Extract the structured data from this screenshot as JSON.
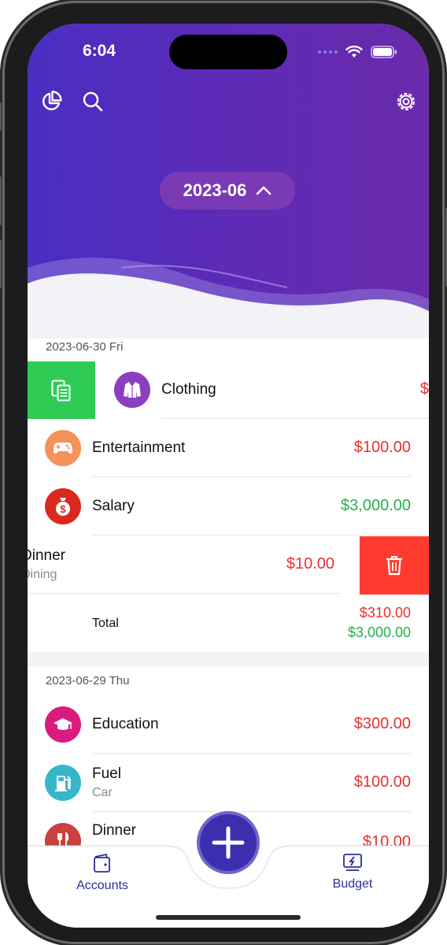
{
  "status": {
    "time": "6:04"
  },
  "header": {
    "month": "2023-06",
    "icons": [
      "pie-chart-icon",
      "search-icon",
      "settings-gear-icon",
      "chevron-up-icon"
    ]
  },
  "colors": {
    "header_start": "#4a2ec2",
    "header_end": "#6b2aab",
    "expense": "#e5322d",
    "income": "#22b14c",
    "copy_action": "#2ecc55",
    "delete_action": "#ff3b30",
    "tab_accent": "#2b2e9b"
  },
  "days": [
    {
      "date": "2023-06-30 Fri",
      "items": [
        {
          "name": "Clothing",
          "icon": "jacket-icon",
          "amount": "$",
          "type": "expense",
          "swipe": "copy"
        },
        {
          "name": "Entertainment",
          "icon": "gamepad-icon",
          "amount": "$100.00",
          "type": "expense"
        },
        {
          "name": "Salary",
          "icon": "money-bag-icon",
          "amount": "$3,000.00",
          "type": "income"
        },
        {
          "name": "Dinner",
          "sub": "Dining",
          "amount": "$10.00",
          "type": "expense",
          "swipe": "delete"
        }
      ],
      "total_label": "Total",
      "total_expense": "$310.00",
      "total_income": "$3,000.00"
    },
    {
      "date": "2023-06-29 Thu",
      "items": [
        {
          "name": "Education",
          "icon": "graduation-cap-icon",
          "amount": "$300.00",
          "type": "expense"
        },
        {
          "name": "Fuel",
          "sub": "Car",
          "icon": "fuel-pump-icon",
          "amount": "$100.00",
          "type": "expense"
        },
        {
          "name": "Dinner",
          "icon": "fork-knife-icon",
          "amount": "$10.00",
          "type": "expense"
        }
      ]
    }
  ],
  "tabbar": {
    "accounts_label": "Accounts",
    "budget_label": "Budget",
    "add_icon": "plus-icon"
  }
}
